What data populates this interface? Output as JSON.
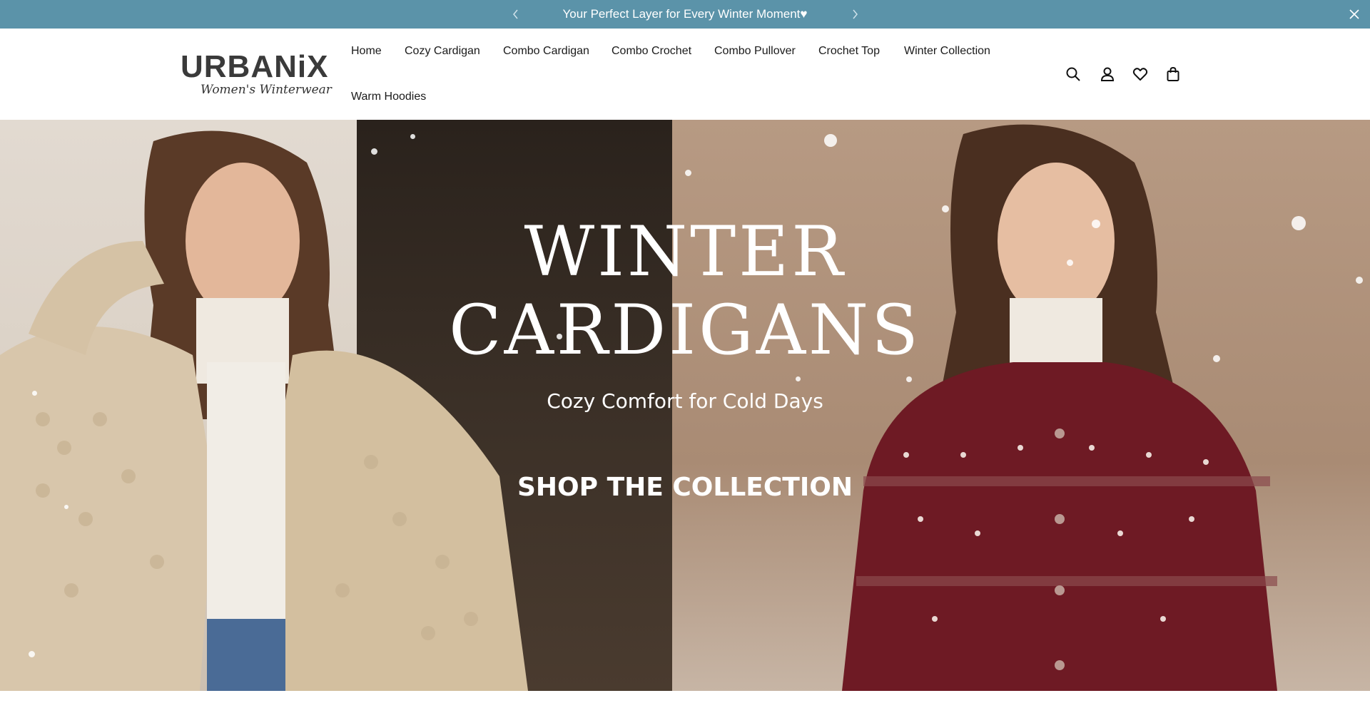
{
  "announcement": {
    "message": "Your Perfect Layer for Every Winter Moment♥",
    "prev_icon": "chevron-left-icon",
    "next_icon": "chevron-right-icon",
    "close_icon": "close-icon",
    "background": "#5b93a9"
  },
  "header": {
    "logo": {
      "brand": "URBANiX",
      "tagline": "Women's Winterwear"
    },
    "nav": [
      {
        "label": "Home"
      },
      {
        "label": "Cozy Cardigan"
      },
      {
        "label": "Combo Cardigan"
      },
      {
        "label": "Combo Crochet"
      },
      {
        "label": "Combo Pullover"
      },
      {
        "label": "Crochet Top"
      },
      {
        "label": "Winter Collection"
      },
      {
        "label": "Warm Hoodies"
      }
    ],
    "icons": [
      "search-icon",
      "account-icon",
      "wishlist-icon",
      "cart-icon"
    ]
  },
  "hero": {
    "title_line1": "WINTER",
    "title_line2": "CARDIGANS",
    "subtitle": "Cozy Comfort for Cold Days",
    "cta": "SHOP THE COLLECTION"
  }
}
